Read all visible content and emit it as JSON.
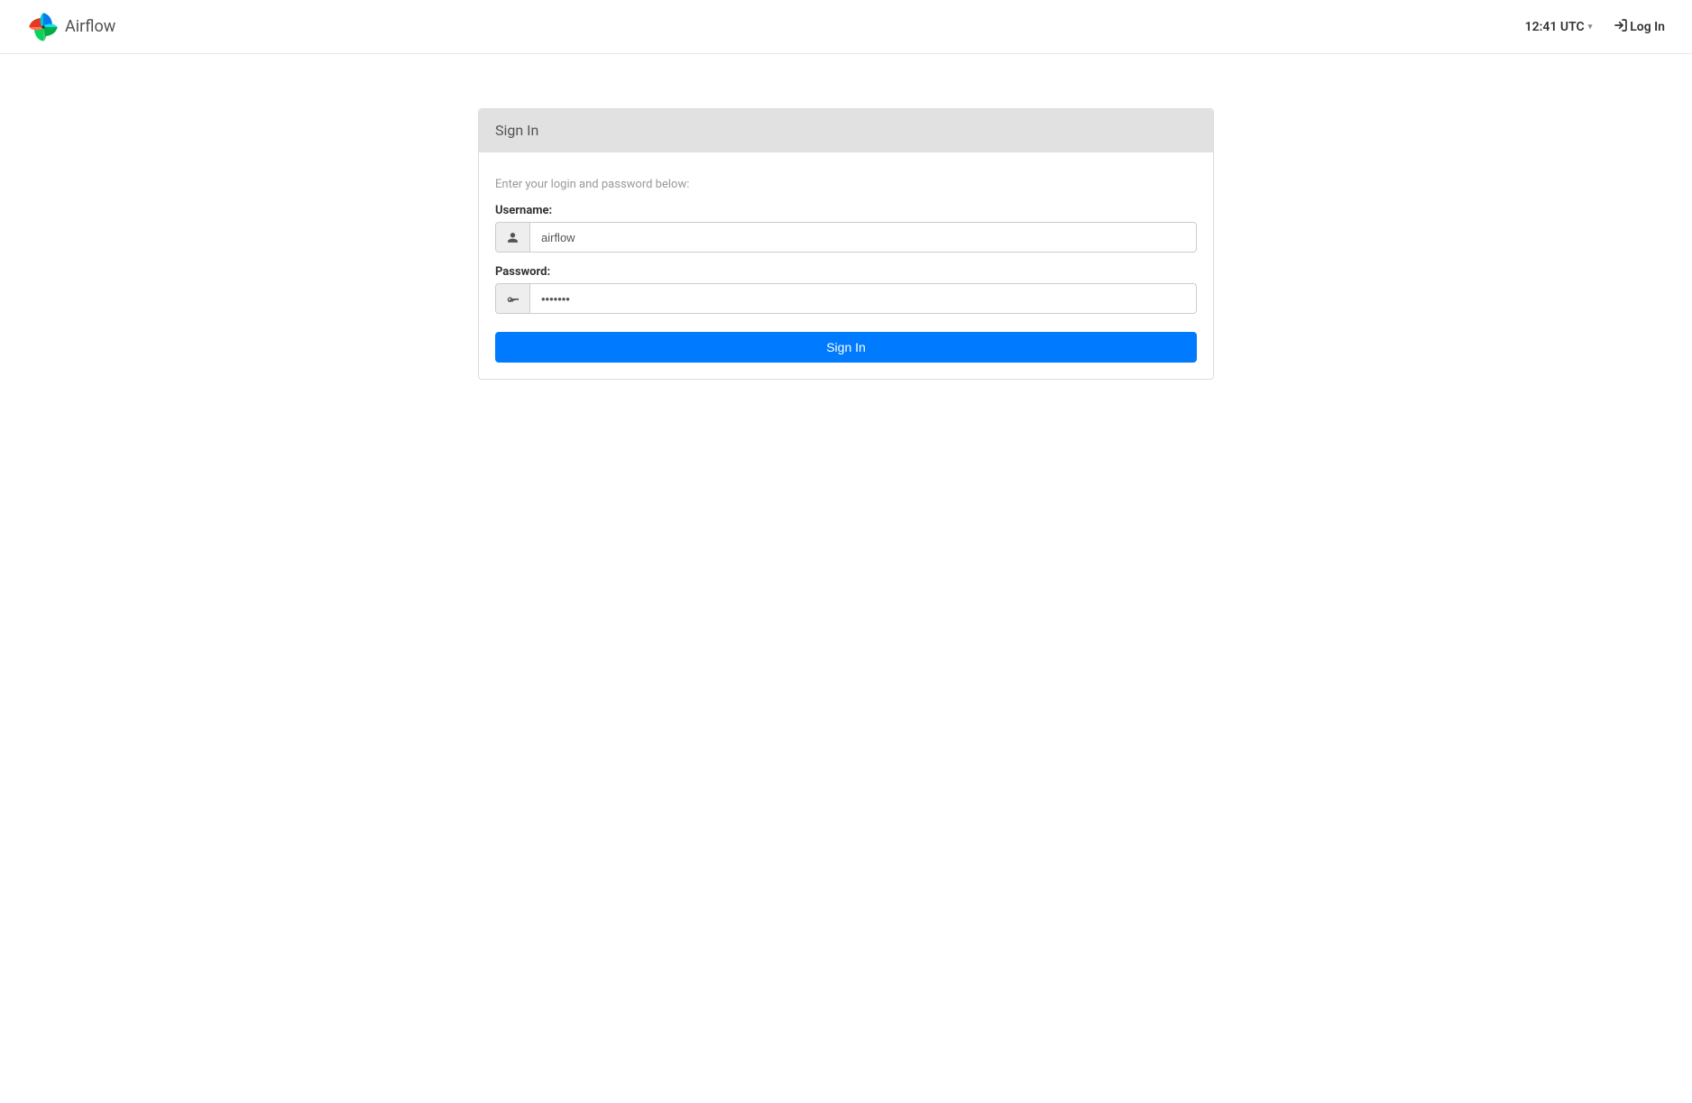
{
  "header": {
    "brand": "Airflow",
    "clock": "12:41 UTC",
    "login_label": "Log In"
  },
  "panel": {
    "title": "Sign In",
    "instructions": "Enter your login and password below:",
    "username_label": "Username:",
    "username_value": "airflow",
    "password_label": "Password:",
    "password_value": "•••••••",
    "submit_label": "Sign In"
  }
}
